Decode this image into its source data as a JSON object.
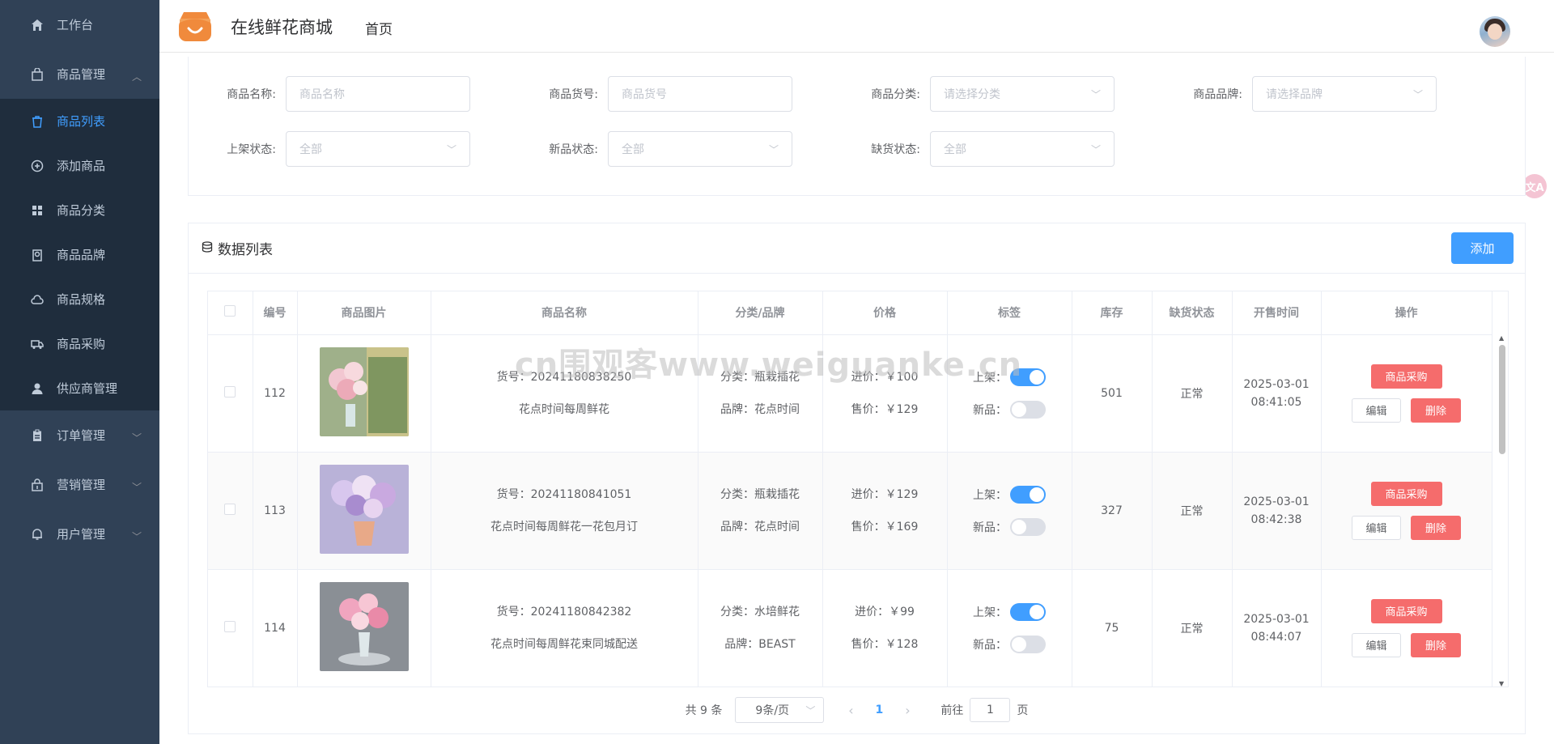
{
  "sidebar": {
    "workbench": "工作台",
    "goods_manage": "商品管理",
    "goods_sub": [
      "商品列表",
      "添加商品",
      "商品分类",
      "商品品牌",
      "商品规格",
      "商品采购",
      "供应商管理"
    ],
    "order_manage": "订单管理",
    "marketing_manage": "营销管理",
    "user_manage": "用户管理"
  },
  "header": {
    "brand": "在线鲜花商城",
    "breadcrumb": "首页"
  },
  "search": {
    "name_label": "商品名称:",
    "name_placeholder": "商品名称",
    "sn_label": "商品货号:",
    "sn_placeholder": "商品货号",
    "category_label": "商品分类:",
    "category_placeholder": "请选择分类",
    "brand_label": "商品品牌:",
    "brand_placeholder": "请选择品牌",
    "publish_label": "上架状态:",
    "publish_value": "全部",
    "new_label": "新品状态:",
    "new_value": "全部",
    "stock_label": "缺货状态:",
    "stock_value": "全部"
  },
  "list": {
    "title": "数据列表",
    "add_label": "添加"
  },
  "table": {
    "columns": [
      "编号",
      "商品图片",
      "商品名称",
      "分类/品牌",
      "价格",
      "标签",
      "库存",
      "缺货状态",
      "开售时间",
      "操作"
    ],
    "rows": [
      {
        "id": "112",
        "sn": "货号：20241180838250",
        "name": "花点时间每周鲜花",
        "category": "分类：瓶栽插花",
        "brand": "品牌：花点时间",
        "cost": "进价：￥100",
        "price": "售价：￥129",
        "publish_label": "上架：",
        "publish_on": true,
        "new_label": "新品：",
        "new_on": false,
        "stock": "501",
        "stock_status": "正常",
        "sale_date": "2025-03-01",
        "sale_time": "08:41:05",
        "buy_label": "商品采购",
        "edit_label": "编辑",
        "delete_label": "删除"
      },
      {
        "id": "113",
        "sn": "货号：20241180841051",
        "name": "花点时间每周鲜花一花包月订",
        "category": "分类：瓶栽插花",
        "brand": "品牌：花点时间",
        "cost": "进价：￥129",
        "price": "售价：￥169",
        "publish_label": "上架：",
        "publish_on": true,
        "new_label": "新品：",
        "new_on": false,
        "stock": "327",
        "stock_status": "正常",
        "sale_date": "2025-03-01",
        "sale_time": "08:42:38",
        "buy_label": "商品采购",
        "edit_label": "编辑",
        "delete_label": "删除"
      },
      {
        "id": "114",
        "sn": "货号：20241180842382",
        "name": "花点时间每周鲜花束同城配送",
        "category": "分类：水培鲜花",
        "brand": "品牌：BEAST",
        "cost": "进价：￥99",
        "price": "售价：￥128",
        "publish_label": "上架：",
        "publish_on": true,
        "new_label": "新品：",
        "new_on": false,
        "stock": "75",
        "stock_status": "正常",
        "sale_date": "2025-03-01",
        "sale_time": "08:44:07",
        "buy_label": "商品采购",
        "edit_label": "编辑",
        "delete_label": "删除"
      }
    ]
  },
  "pager": {
    "total": "共 9 条",
    "size": "9条/页",
    "current": "1",
    "goto_label": "前往",
    "goto_value": "1",
    "page_unit": "页"
  },
  "watermark": "cn围观客www.weiguanke.cn",
  "float_icon": "文A",
  "colors": {
    "sidebar_bg": "#304156",
    "submenu_bg": "#1f2d3d",
    "primary": "#409eff",
    "danger": "#f56c6c",
    "logo": "#f08a3c"
  }
}
